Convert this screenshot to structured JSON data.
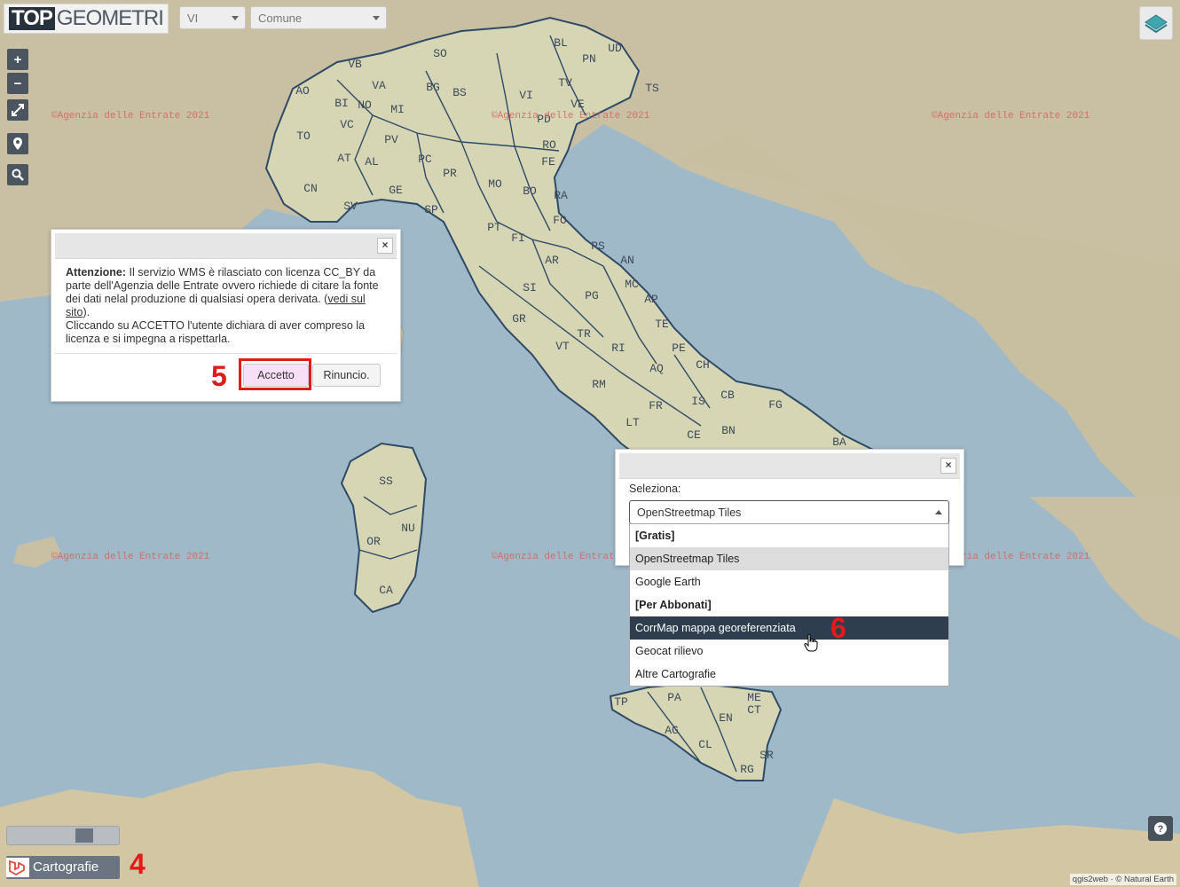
{
  "header": {
    "logo_top": "TOP",
    "logo_rest": "GEOMETRI",
    "province_select": "VI",
    "comune_select": "Comune"
  },
  "map_controls": {
    "zoom_in": "+",
    "zoom_out": "−"
  },
  "watermark": "©Agenzia delle Entrate 2021",
  "provinces": [
    "BL",
    "SO",
    "PN",
    "UD",
    "VB",
    "VA",
    "BG",
    "BS",
    "TV",
    "TS",
    "VI",
    "AO",
    "BI",
    "NO",
    "MI",
    "VE",
    "PD",
    "VC",
    "PV",
    "TO",
    "AT",
    "AL",
    "PC",
    "RO",
    "FE",
    "PR",
    "CN",
    "GE",
    "MO",
    "BO",
    "SV",
    "SP",
    "RA",
    "FO",
    "PT",
    "FI",
    "PS",
    "AR",
    "AN",
    "SI",
    "MC",
    "PG",
    "GR",
    "AP",
    "TE",
    "TR",
    "RI",
    "VT",
    "PE",
    "CH",
    "AQ",
    "RM",
    "IS",
    "CB",
    "FG",
    "FR",
    "LT",
    "CE",
    "BN",
    "BA",
    "SS",
    "NU",
    "OR",
    "CA",
    "TP",
    "PA",
    "ME",
    "EN",
    "AG",
    "CL",
    "CT",
    "SR",
    "RG"
  ],
  "warning_dialog": {
    "close": "×",
    "bold": "Attenzione:",
    "text1": " Il servizio WMS è rilasciato con licenza CC_BY da parte dell'Agenzia delle Entrate ovvero richiede di citare la fonte dei dati nelal produzione di qualsiasi opera derivata. (",
    "link": "vedi sul sito",
    "text2": ").",
    "text3": "Cliccando su ACCETTO l'utente dichiara di aver compreso la licenza e si impegna a rispettarla.",
    "accept": "Accetto",
    "reject": "Rinuncio."
  },
  "layer_dialog": {
    "close": "×",
    "label": "Seleziona:",
    "selected": "OpenStreetmap Tiles",
    "options": [
      {
        "label": "[Gratis]"
      },
      {
        "label": "OpenStreetmap Tiles"
      },
      {
        "label": "Google Earth"
      },
      {
        "label": "[Per Abbonati]"
      },
      {
        "label": "CorrMap mappa georeferenziata"
      },
      {
        "label": "Geocat rilievo"
      },
      {
        "label": "Altre Cartografie"
      }
    ]
  },
  "annotations": {
    "n4": "4",
    "n5": "5",
    "n6": "6"
  },
  "bottom": {
    "cartografie": "Cartografie",
    "attribution": "qgis2web · © Natural Earth"
  },
  "colors": {
    "sea": "#9fb9c9",
    "land": "#c9c0a4",
    "italy": "#d6d6b4",
    "border": "#2f4a66",
    "annotation_red": "#e41a1a",
    "highlight": "#2f3e4e"
  }
}
